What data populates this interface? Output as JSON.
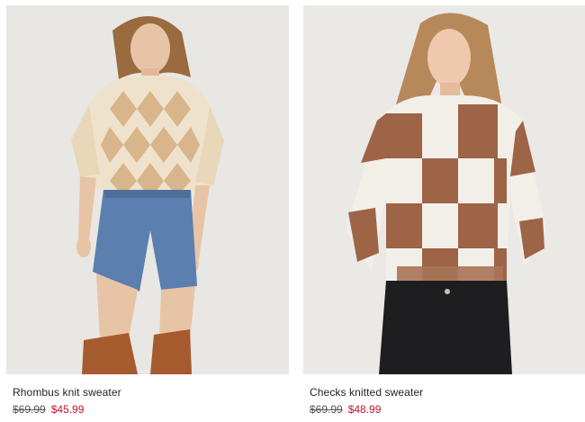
{
  "products": [
    {
      "name": "Rhombus knit sweater",
      "original_price": "$69.99",
      "sale_price": "$45.99",
      "image": "model-argyle-sweater-denim-shorts-boots"
    },
    {
      "name": "Checks knitted sweater",
      "original_price": "$69.99",
      "sale_price": "$48.99",
      "image": "model-checkered-brown-white-sweater-black-jeans"
    }
  ],
  "colors": {
    "sale_price": "#c8102e",
    "background": "#e9e8e6",
    "text": "#222222"
  }
}
